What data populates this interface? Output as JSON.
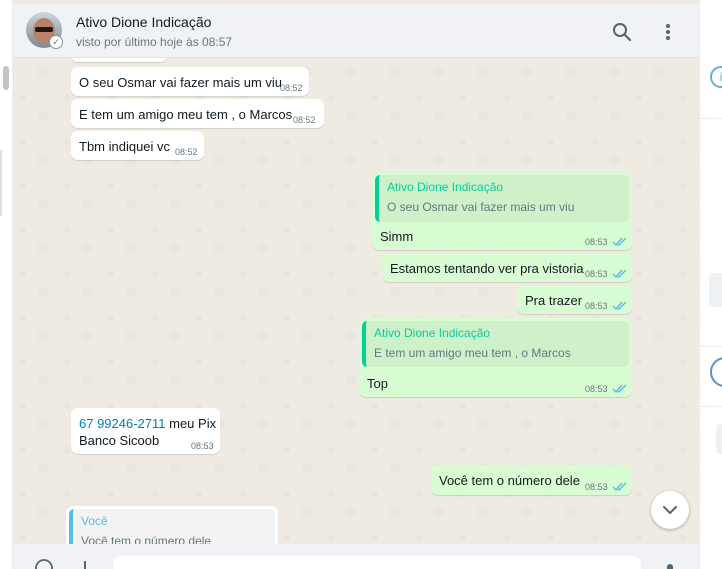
{
  "header": {
    "contact_name": "Ativo Dione Indicação",
    "last_seen": "visto por último hoje às 08:57",
    "search_icon": "search-icon",
    "menu_icon": "kebab-menu-icon"
  },
  "colors": {
    "incoming_bubble": "#ffffff",
    "outgoing_bubble": "#d9fdd3",
    "chat_background": "#efeae2",
    "quote_accent": "#06cf9c",
    "quote_accent_you": "#53bdeb",
    "read_ticks": "#53bdeb",
    "link": "#027eb5"
  },
  "messages": [
    {
      "text": "O seu Osmar vai fazer mais um viu",
      "time": "08:52"
    },
    {
      "text": "E tem um amigo meu tem , o Marcos",
      "time": "08:52"
    },
    {
      "text": "Tbm indiquei vc",
      "time": "08:52"
    },
    {
      "quote_author": "Ativo Dione Indicação",
      "quote_text": "O seu Osmar vai fazer mais um viu",
      "text": "Simm",
      "time": "08:53"
    },
    {
      "text": "Estamos tentando ver pra vistoria",
      "time": "08:53"
    },
    {
      "text": "Pra trazer",
      "time": "08:53"
    },
    {
      "quote_author": "Ativo Dione Indicação",
      "quote_text": "E tem um amigo meu tem , o Marcos",
      "text": "Top",
      "time": "08:53"
    },
    {
      "link": "67 99246-2711",
      "text": " meu Pix",
      "text2": "Banco Sicoob",
      "time": "08:53"
    },
    {
      "text": "Você tem o número dele",
      "time": "08:53"
    },
    {
      "quote_author": "Você",
      "quote_text": "Você tem o número dele"
    }
  ],
  "composer": {
    "emoji_icon": "emoji-icon",
    "attach_icon": "plus-icon",
    "mic_icon": "mic-icon"
  }
}
